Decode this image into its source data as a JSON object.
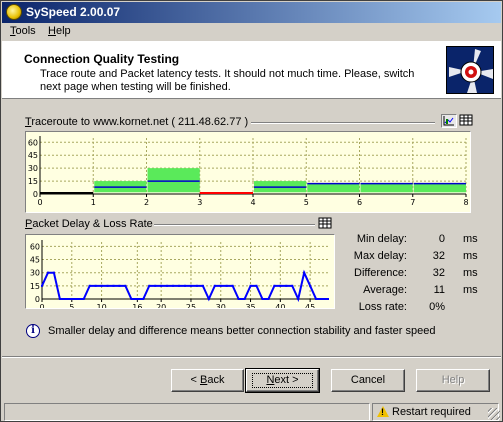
{
  "window": {
    "title": "SySpeed 2.00.07",
    "controls": {
      "minimize": "_",
      "maximize": "□",
      "close": "×"
    }
  },
  "menu": [
    {
      "label": "Tools",
      "accel": "T",
      "rest": "ools"
    },
    {
      "label": "Help",
      "accel": "H",
      "rest": "elp"
    }
  ],
  "header": {
    "title": "Connection Quality Testing",
    "description": "Trace route and Packet latency tests. It should not much time. Please, switch next page when testing will be finished."
  },
  "traceroute": {
    "label_accel": "T",
    "label_rest": "raceroute to www.kornet.net ( 211.48.62.77 )"
  },
  "packet": {
    "label_accel": "P",
    "label_rest": "acket Delay & Loss Rate"
  },
  "chart_data": [
    {
      "type": "bar",
      "title": "Traceroute to www.kornet.net ( 211.48.62.77 )",
      "x_ticks": [
        0,
        1,
        2,
        3,
        4,
        5,
        6,
        7,
        8
      ],
      "y_ticks": [
        0,
        15,
        30,
        45,
        60
      ],
      "ylim": [
        0,
        65
      ],
      "xlim": [
        0,
        8
      ],
      "grid": true,
      "hops": [
        {
          "from": 0,
          "to": 1,
          "min": 0,
          "avg": 0,
          "max": 0,
          "color": "#000000"
        },
        {
          "from": 1,
          "to": 2,
          "min": 2,
          "avg": 8,
          "max": 15,
          "color": "#5aea5a"
        },
        {
          "from": 2,
          "to": 3,
          "min": 2,
          "avg": 15,
          "max": 30,
          "color": "#5aea5a"
        },
        {
          "from": 3,
          "to": 4,
          "min": 0,
          "avg": 0,
          "max": 0,
          "color": "#ff0000"
        },
        {
          "from": 4,
          "to": 5,
          "min": 2,
          "avg": 8,
          "max": 15,
          "color": "#5aea5a"
        },
        {
          "from": 5,
          "to": 6,
          "min": 2,
          "avg": 12,
          "max": 12,
          "color": "#5aea5a"
        },
        {
          "from": 6,
          "to": 7,
          "min": 2,
          "avg": 12,
          "max": 12,
          "color": "#5aea5a"
        },
        {
          "from": 7,
          "to": 8,
          "min": 2,
          "avg": 12,
          "max": 12,
          "color": "#5aea5a"
        }
      ]
    },
    {
      "type": "line",
      "title": "Packet Delay & Loss Rate",
      "x_ticks": [
        0,
        5,
        10,
        16,
        20,
        25,
        30,
        35,
        40,
        45
      ],
      "y_ticks": [
        0,
        15,
        30,
        45,
        60
      ],
      "xlim": [
        0,
        48
      ],
      "ylim": [
        0,
        65
      ],
      "grid": true,
      "series": [
        {
          "color": "#0000ff",
          "x": [
            0,
            1,
            2,
            3,
            4,
            5,
            6,
            7,
            8,
            9,
            10,
            11,
            12,
            13,
            14,
            15,
            16,
            17,
            18,
            19,
            20,
            21,
            22,
            23,
            24,
            25,
            26,
            27,
            28,
            29,
            30,
            31,
            32,
            33,
            34,
            35,
            36,
            37,
            38,
            39,
            40,
            41,
            42,
            43,
            44,
            45,
            46,
            47,
            48
          ],
          "y": [
            15,
            30,
            30,
            0,
            0,
            0,
            0,
            0,
            15,
            15,
            15,
            15,
            15,
            15,
            15,
            0,
            0,
            0,
            15,
            15,
            15,
            15,
            15,
            15,
            15,
            15,
            15,
            15,
            0,
            15,
            15,
            15,
            15,
            0,
            0,
            15,
            15,
            0,
            0,
            15,
            15,
            15,
            15,
            0,
            30,
            15,
            0,
            0,
            0
          ]
        }
      ]
    }
  ],
  "stats": [
    {
      "label": "Min delay:",
      "value": "0",
      "unit": "ms"
    },
    {
      "label": "Max delay:",
      "value": "32",
      "unit": "ms"
    },
    {
      "label": "Difference:",
      "value": "32",
      "unit": "ms"
    },
    {
      "label": "Average:",
      "value": "11",
      "unit": "ms"
    },
    {
      "label": "Loss rate:",
      "value": "0%",
      "unit": ""
    }
  ],
  "info": "Smaller delay and difference means better connection stability and faster speed",
  "buttons": {
    "back": {
      "prefix": "< ",
      "accel": "B",
      "rest": "ack"
    },
    "next": {
      "accel": "N",
      "rest": "ext >"
    },
    "cancel": "Cancel",
    "help": "Help"
  },
  "status": "Restart required",
  "colors": {
    "title_start": "#0a246a",
    "title_end": "#a6caf0",
    "chart_bg": "#ffffe1",
    "grid": "#b8b870",
    "bar": "#5aea5a",
    "line": "#0000ff"
  },
  "icons": [
    "app-icon",
    "graph-view-icon",
    "table-view-icon",
    "info-icon",
    "warning-icon"
  ]
}
